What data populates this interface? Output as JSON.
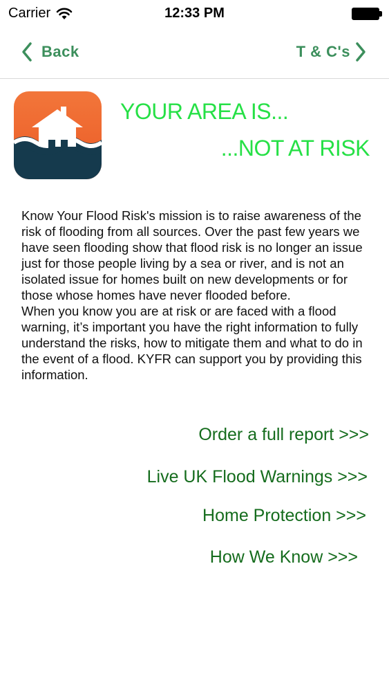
{
  "status_bar": {
    "carrier": "Carrier",
    "time": "12:33 PM",
    "wifi_icon": "wifi-icon",
    "battery_icon": "battery-icon"
  },
  "nav": {
    "back_label": "Back",
    "terms_label": "T & C's",
    "accent_color": "#3c8f5c"
  },
  "logo": {
    "icon": "flood-house-icon",
    "colors": {
      "top": "#f0692c",
      "bottom": "#153a4d",
      "house": "#ffffff"
    }
  },
  "result": {
    "line1": "YOUR AREA IS...",
    "line2": "...NOT AT RISK",
    "color": "#26e046"
  },
  "mission": {
    "paragraph1": "Know Your Flood Risk's mission is to raise awareness of the risk of flooding from all sources. Over the past few years we have seen flooding show that flood risk is no longer an issue just for those people living by a sea or river, and is not an isolated issue for homes built on new developments or for those whose homes have never flooded before.",
    "paragraph2": "When you know you are at risk or are faced with a flood warning, it’s important you have the right information to fully understand the risks, how to mitigate them and what to do in the event of a flood. KYFR can support you by providing this information."
  },
  "links": {
    "order_report": "Order a full report >>>",
    "flood_warnings": "Live UK Flood Warnings >>>",
    "home_protection": "Home Protection >>>",
    "how_we_know": "How We Know >>>",
    "color": "#156c1d"
  }
}
